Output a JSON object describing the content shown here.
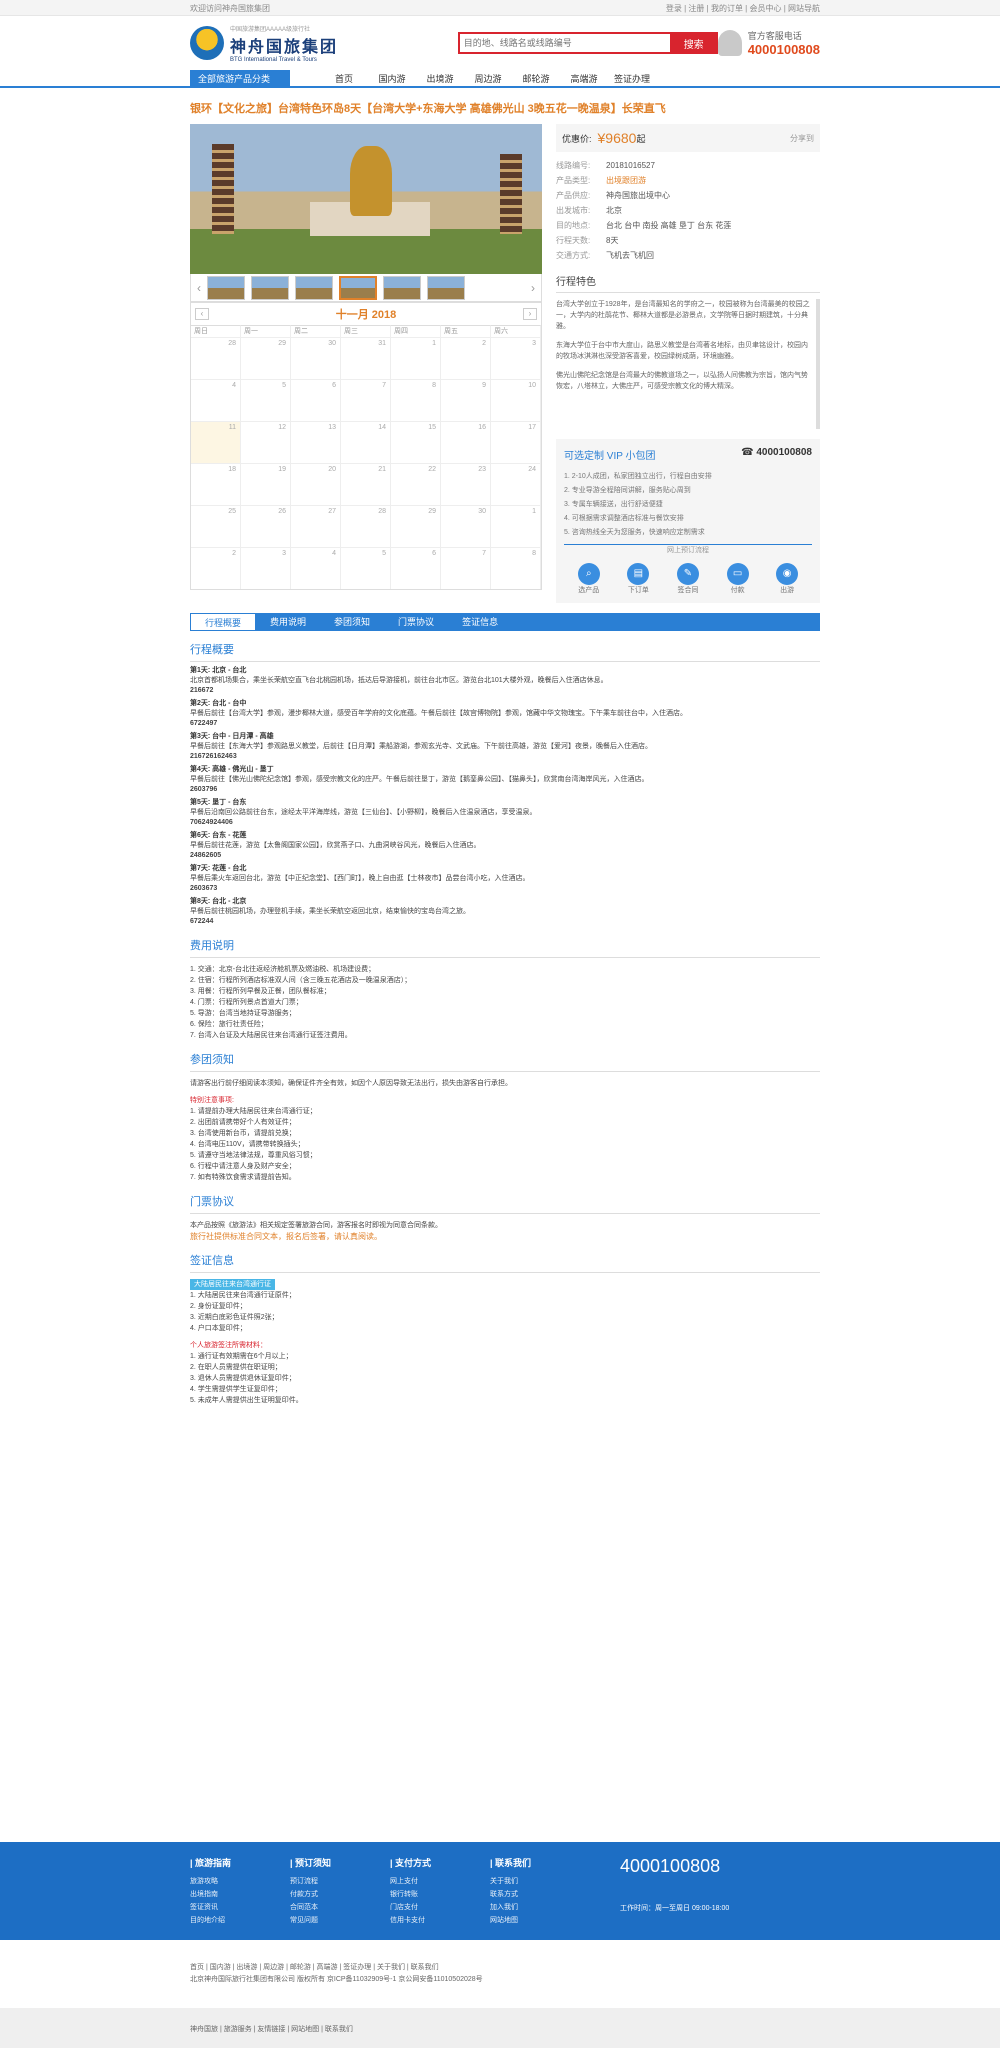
{
  "topbar": {
    "left": "欢迎访问神舟国旅集团",
    "right": "登录 | 注册 | 我的订单 | 会员中心 | 网站导航"
  },
  "header": {
    "logo_cn": "神舟国旅集团",
    "logo_en": "BTG International Travel & Tours",
    "logo_sub": "中国旅游集团AAAAA级旅行社",
    "search_placeholder": "目的地、线路名或线路编号",
    "search_button": "搜索",
    "hotline_label": "官方客服电话",
    "hotline_number": "4000100808"
  },
  "nav": {
    "category": "全部旅游产品分类",
    "items": [
      "首页",
      "国内游",
      "出境游",
      "周边游",
      "邮轮游",
      "高端游",
      "签证办理"
    ]
  },
  "product": {
    "title": "银环【文化之旅】台湾特色环岛8天【台湾大学+东海大学 高雄佛光山 3晚五花一晚温泉】长荣直飞",
    "price_label": "优惠价:",
    "price": "¥9680",
    "price_unit": "起",
    "share": "分享到",
    "info": [
      {
        "k": "线路编号:",
        "v": "20181016527"
      },
      {
        "k": "产品类型:",
        "v": "出境跟团游",
        "link": true
      },
      {
        "k": "产品供应:",
        "v": "神舟国旅出境中心"
      },
      {
        "k": "出发城市:",
        "v": "北京"
      },
      {
        "k": "目的地点:",
        "v": "台北 台中 南投 高雄 垦丁 台东 花莲"
      },
      {
        "k": "行程天数:",
        "v": "8天"
      },
      {
        "k": "交通方式:",
        "v": "飞机去飞机回"
      }
    ],
    "feature_title": "行程特色",
    "features": [
      "台湾大学创立于1928年，是台湾最知名的学府之一，校园被称为台湾最美的校园之一，大学内的杜鹃花节、椰林大道都是必游景点，文学院等日据时期建筑，十分典雅。",
      "东海大学位于台中市大度山，路思义教堂是台湾著名地标，由贝聿铭设计，校园内的牧场冰淇淋也深受游客喜爱，校园绿树成荫，环境幽雅。",
      "佛光山佛陀纪念馆是台湾最大的佛教道场之一，以弘扬人间佛教为宗旨，馆内气势恢宏，八塔林立，大佛庄严，可感受宗教文化的博大精深。"
    ],
    "vip": {
      "title": "可选定制 VIP 小包团",
      "phone": "4000100808",
      "items": [
        "1. 2-10人成团，私家团独立出行，行程自由安排",
        "2. 专业导游全程陪同讲解，服务贴心周到",
        "3. 专属车辆接送，出行舒适便捷",
        "4. 可根据需求调整酒店标准与餐饮安排",
        "5. 咨询热线全天为您服务，快速响应定制需求"
      ],
      "divider": "网上预订流程",
      "steps": [
        "选产品",
        "下订单",
        "签合同",
        "付款",
        "出游"
      ]
    }
  },
  "calendar": {
    "month": "十一月 2018",
    "prev": "‹",
    "next": "›",
    "dows": [
      "周日",
      "周一",
      "周二",
      "周三",
      "周四",
      "周五",
      "周六"
    ],
    "days": [
      "28",
      "29",
      "30",
      "31",
      "1",
      "2",
      "3",
      "4",
      "5",
      "6",
      "7",
      "8",
      "9",
      "10",
      "11",
      "12",
      "13",
      "14",
      "15",
      "16",
      "17",
      "18",
      "19",
      "20",
      "21",
      "22",
      "23",
      "24",
      "25",
      "26",
      "27",
      "28",
      "29",
      "30",
      "1",
      "2",
      "3",
      "4",
      "5",
      "6",
      "7",
      "8"
    ]
  },
  "tabs": [
    "行程概要",
    "费用说明",
    "参团须知",
    "门票协议",
    "签证信息"
  ],
  "itinerary": {
    "title": "行程概要",
    "days": [
      {
        "h": "第1天: 北京 - 台北",
        "t": "北京首都机场集合，乘坐长荣航空直飞台北桃园机场，抵达后导游接机，前往台北市区。游览台北101大楼外观，晚餐后入住酒店休息。",
        "n": "216672"
      },
      {
        "h": "第2天: 台北 - 台中",
        "t": "早餐后前往【台湾大学】参观，漫步椰林大道，感受百年学府的文化底蕴。午餐后前往【故宫博物院】参观，馆藏中华文物瑰宝。下午乘车前往台中，入住酒店。",
        "n": "6722497"
      },
      {
        "h": "第3天: 台中 - 日月潭 - 高雄",
        "t": "早餐后前往【东海大学】参观路思义教堂，后前往【日月潭】乘船游湖，参观玄光寺、文武庙。下午前往高雄，游览【爱河】夜景，晚餐后入住酒店。",
        "n": "216726162463"
      },
      {
        "h": "第4天: 高雄 - 佛光山 - 垦丁",
        "t": "早餐后前往【佛光山佛陀纪念馆】参观，感受宗教文化的庄严。午餐后前往垦丁，游览【鹅銮鼻公园】、【猫鼻头】，欣赏南台湾海岸风光，入住酒店。",
        "n": "2603796"
      },
      {
        "h": "第5天: 垦丁 - 台东",
        "t": "早餐后沿南回公路前往台东，途经太平洋海岸线，游览【三仙台】、【小野柳】，晚餐后入住温泉酒店，享受温泉。",
        "n": "70624924406"
      },
      {
        "h": "第6天: 台东 - 花莲",
        "t": "早餐后前往花莲，游览【太鲁阁国家公园】，欣赏燕子口、九曲洞峡谷风光，晚餐后入住酒店。",
        "n": "24862605"
      },
      {
        "h": "第7天: 花莲 - 台北",
        "t": "早餐后乘火车返回台北，游览【中正纪念堂】、【西门町】，晚上自由逛【士林夜市】品尝台湾小吃，入住酒店。",
        "n": "2603673"
      },
      {
        "h": "第8天: 台北 - 北京",
        "t": "早餐后前往桃园机场，办理登机手续，乘坐长荣航空返回北京，结束愉快的宝岛台湾之旅。",
        "n": "672244"
      }
    ]
  },
  "fees": {
    "title": "费用说明",
    "lines": [
      "1. 交通：北京-台北往返经济舱机票及燃油税、机场建设费；",
      "2. 住宿：行程所列酒店标准双人间（含三晚五花酒店及一晚温泉酒店）；",
      "3. 用餐：行程所列早餐及正餐，团队餐标准；",
      "4. 门票：行程所列景点首道大门票；",
      "5. 导游：台湾当地持证导游服务；",
      "6. 保险：旅行社责任险；",
      "7. 台湾入台证及大陆居民往来台湾通行证签注费用。"
    ]
  },
  "notice": {
    "title": "参团须知",
    "intro": "请游客出行前仔细阅读本须知，确保证件齐全有效，如因个人原因导致无法出行，损失由游客自行承担。",
    "sub": "特别注意事项:",
    "lines": [
      "1. 请提前办理大陆居民往来台湾通行证；",
      "2. 出团前请携带好个人有效证件；",
      "3. 台湾使用新台币，请提前兑换；",
      "4. 台湾电压110V，请携带转换插头；",
      "5. 请遵守当地法律法规，尊重风俗习惯；",
      "6. 行程中请注意人身及财产安全；",
      "7. 如有特殊饮食需求请提前告知。"
    ]
  },
  "contract": {
    "title": "门票协议",
    "lines": [
      "本产品按照《旅游法》相关规定签署旅游合同，游客报名时即视为同意合同条款。",
      "旅行社提供标准合同文本，报名后签署，请认真阅读。"
    ]
  },
  "visa": {
    "title": "签证信息",
    "badge": "大陆居民往来台湾通行证",
    "lines": [
      "1. 大陆居民往来台湾通行证原件；",
      "2. 身份证复印件；",
      "3. 近期白底彩色证件照2张；",
      "4. 户口本复印件；"
    ],
    "sub": "个人旅游签注所需材料：",
    "lines2": [
      "1. 通行证有效期需在6个月以上；",
      "2. 在职人员需提供在职证明；",
      "3. 退休人员需提供退休证复印件；",
      "4. 学生需提供学生证复印件；",
      "5. 未成年人需提供出生证明复印件。"
    ]
  },
  "footer": {
    "cols": [
      {
        "h": "| 旅游指南",
        "l": [
          "旅游攻略",
          "出境指南",
          "签证资讯",
          "目的地介绍"
        ]
      },
      {
        "h": "| 预订须知",
        "l": [
          "预订流程",
          "付款方式",
          "合同范本",
          "常见问题"
        ]
      },
      {
        "h": "| 支付方式",
        "l": [
          "网上支付",
          "银行转账",
          "门店支付",
          "信用卡支付"
        ]
      },
      {
        "h": "| 联系我们",
        "l": [
          "关于我们",
          "联系方式",
          "加入我们",
          "网站地图"
        ]
      }
    ],
    "phone": "4000100808",
    "hours": "工作时间：周一至周日 09:00-18:00"
  },
  "footer_links": {
    "line1": "首页 | 国内游 | 出境游 | 周边游 | 邮轮游 | 高端游 | 签证办理 | 关于我们 | 联系我们",
    "line2": "北京神舟国际旅行社集团有限公司 版权所有 京ICP备11032909号-1 京公网安备11010502028号"
  },
  "bottom_links": "神舟国旅 | 旅游服务 | 友情链接 | 网站地图 | 联系我们"
}
